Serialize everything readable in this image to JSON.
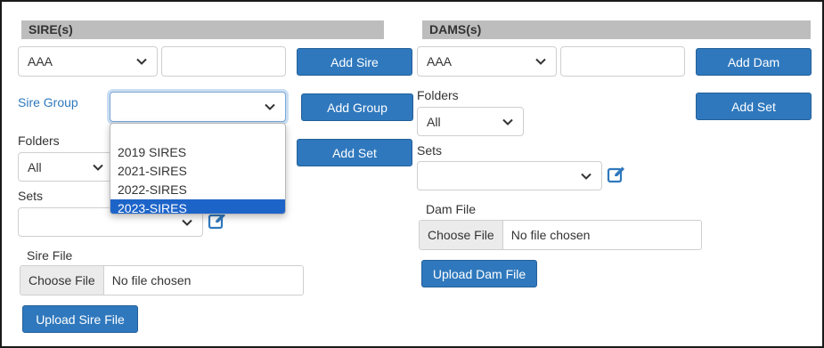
{
  "sires": {
    "header": "SIRE(s)",
    "sire_select": "AAA",
    "add_sire_label": "Add Sire",
    "sire_group_label": "Sire Group",
    "sire_group_value": "",
    "add_group_label": "Add Group",
    "folders_label": "Folders",
    "folders_value": "All",
    "add_set_label": "Add Set",
    "sets_label": "Sets",
    "sets_value": "",
    "file_label": "Sire File",
    "choose_file_label": "Choose File",
    "file_status": "No file chosen",
    "upload_label": "Upload Sire File",
    "group_options": [
      "2019 SIRES",
      "2021-SIRES",
      "2022-SIRES",
      "2023-SIRES"
    ]
  },
  "dams": {
    "header": "DAMS(s)",
    "dam_select": "AAA",
    "add_dam_label": "Add Dam",
    "folders_label": "Folders",
    "folders_value": "All",
    "add_set_label": "Add Set",
    "sets_label": "Sets",
    "sets_value": "",
    "file_label": "Dam File",
    "choose_file_label": "Choose File",
    "file_status": "No file chosen",
    "upload_label": "Upload Dam File"
  },
  "colors": {
    "button": "#2f78bd",
    "header_bg": "#bdbdbd",
    "label_accent": "#2f78bd",
    "dropdown_selected": "#1d64c9"
  },
  "icons": [
    "chevron-down-icon",
    "edit-icon"
  ]
}
